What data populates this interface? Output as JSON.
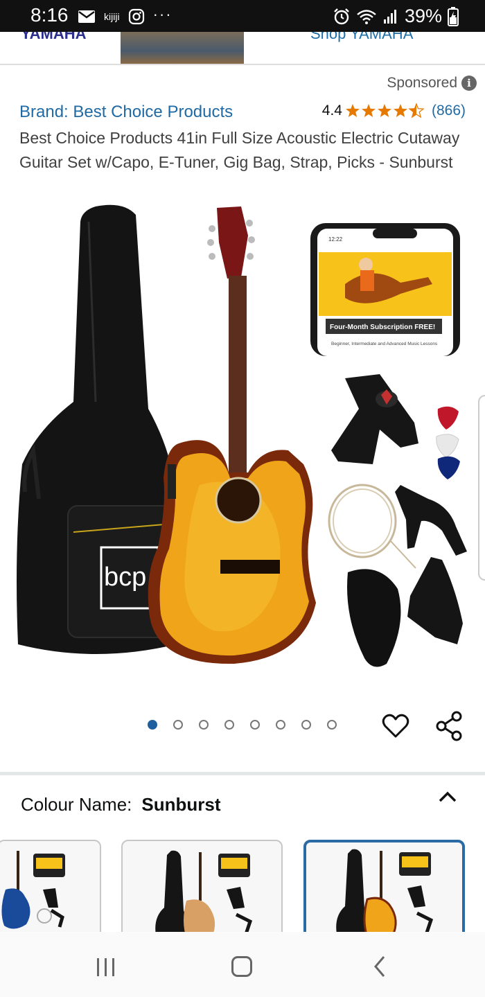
{
  "status_bar": {
    "time": "8:16",
    "kijiji": "kijiji",
    "battery": "39%"
  },
  "ad_banner": {
    "brand": "YAMAHA",
    "cta": "Shop YAMAHA"
  },
  "sponsored_label": "Sponsored",
  "product": {
    "brand": "Brand: Best Choice Products",
    "rating_value": "4.4",
    "rating_stars": 4.4,
    "review_count": "(866)",
    "title": "Best Choice Products 41in Full Size Acoustic Electric Cutaway Guitar Set w/Capo, E-Tuner, Gig Bag, Strap, Picks - Sunburst",
    "bag_logo": "bcp",
    "phone_time": "12:22",
    "subscription_title": "Four-Month Subscription FREE!",
    "subscription_sub": "Beginner, Intermediate and Advanced Music Lessons"
  },
  "carousel": {
    "count": 8,
    "active_index": 0
  },
  "colour": {
    "label": "Colour Name:",
    "value": "Sunburst"
  },
  "colors": {
    "accent_blue": "#1f5fa0",
    "link": "#1f6aa5",
    "star": "#e67a00"
  }
}
